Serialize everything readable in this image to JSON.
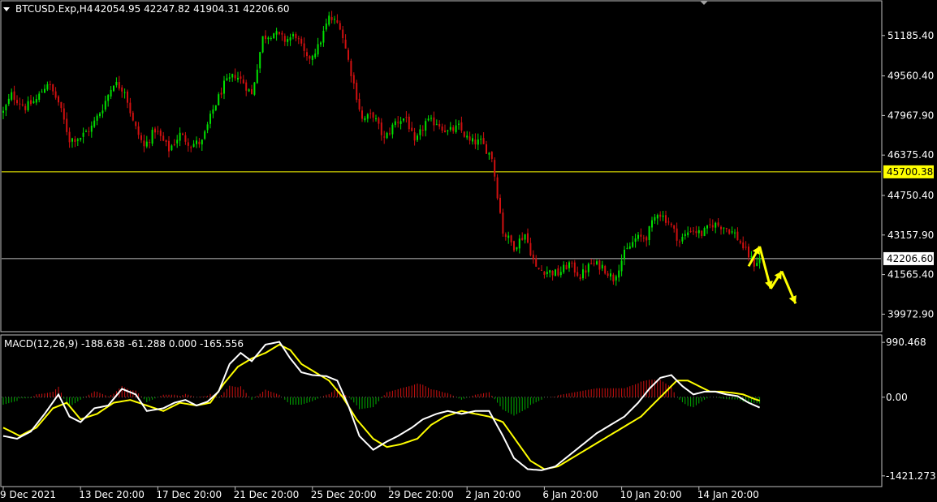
{
  "header": {
    "symbol": "BTCUSD.Exp,H4",
    "ohlc": "42054.95 42247.82 41904.31 42206.60",
    "macd_label": "MACD(12,26,9) -188.638 -61.288 0.000 -165.556"
  },
  "colors": {
    "background": "#000000",
    "bull": "#00e000",
    "bear": "#d01010",
    "macd_line": "#ffffff",
    "signal_line": "#ffff00",
    "hist_pos": "#d01010",
    "hist_neg": "#00b000",
    "resistance": "#ffff00",
    "current": "#c0c0c0",
    "arrows": "#ffff00"
  },
  "chart_data": [
    {
      "type": "candlestick",
      "price_ticks": [
        {
          "value": 51185.4,
          "label": "51185.40"
        },
        {
          "value": 49560.4,
          "label": "49560.40"
        },
        {
          "value": 47967.9,
          "label": "47967.90"
        },
        {
          "value": 46375.4,
          "label": "46375.40"
        },
        {
          "value": 44750.4,
          "label": "44750.40"
        },
        {
          "value": 43157.9,
          "label": "43157.90"
        },
        {
          "value": 41565.4,
          "label": "41565.40"
        },
        {
          "value": 39972.9,
          "label": "39972.90"
        }
      ],
      "ylim": [
        39300,
        52550
      ],
      "horizontal_lines": [
        {
          "value": 45700.38,
          "label": "45700.38",
          "kind": "resistance"
        },
        {
          "value": 42206.6,
          "label": "42206.60",
          "kind": "current"
        }
      ],
      "time_labels": [
        "9 Dec 2021",
        "13 Dec 20:00",
        "17 Dec 20:00",
        "21 Dec 20:00",
        "25 Dec 20:00",
        "29 Dec 20:00",
        "2 Jan 20:00",
        "6 Jan 20:00",
        "10 Jan 20:00",
        "14 Jan 20:00"
      ],
      "closes": [
        [
          0,
          48100
        ],
        [
          3,
          48800
        ],
        [
          8,
          48300
        ],
        [
          12,
          48600
        ],
        [
          16,
          49300
        ],
        [
          20,
          48500
        ],
        [
          24,
          47000
        ],
        [
          28,
          47100
        ],
        [
          32,
          47500
        ],
        [
          36,
          48300
        ],
        [
          40,
          49300
        ],
        [
          44,
          49000
        ],
        [
          47,
          47700
        ],
        [
          51,
          46700
        ],
        [
          55,
          47400
        ],
        [
          60,
          46600
        ],
        [
          64,
          47200
        ],
        [
          68,
          46800
        ],
        [
          72,
          46900
        ],
        [
          76,
          48200
        ],
        [
          80,
          49200
        ],
        [
          84,
          49600
        ],
        [
          87,
          49300
        ],
        [
          90,
          48800
        ],
        [
          94,
          51100
        ],
        [
          98,
          51300
        ],
        [
          102,
          51000
        ],
        [
          106,
          51200
        ],
        [
          110,
          50200
        ],
        [
          114,
          50700
        ],
        [
          118,
          51900
        ],
        [
          122,
          51600
        ],
        [
          126,
          49700
        ],
        [
          130,
          47800
        ],
        [
          134,
          48000
        ],
        [
          138,
          47000
        ],
        [
          142,
          47700
        ],
        [
          146,
          47900
        ],
        [
          149,
          46800
        ],
        [
          153,
          47700
        ],
        [
          157,
          47700
        ],
        [
          161,
          47300
        ],
        [
          165,
          47500
        ],
        [
          169,
          46900
        ],
        [
          173,
          46900
        ],
        [
          177,
          46300
        ],
        [
          181,
          43300
        ],
        [
          185,
          42700
        ],
        [
          189,
          43200
        ],
        [
          193,
          41800
        ],
        [
          197,
          41700
        ],
        [
          201,
          41600
        ],
        [
          205,
          42000
        ],
        [
          209,
          41500
        ],
        [
          213,
          42000
        ],
        [
          217,
          41900
        ],
        [
          221,
          41400
        ],
        [
          225,
          42400
        ],
        [
          229,
          43000
        ],
        [
          233,
          43100
        ],
        [
          237,
          44100
        ],
        [
          241,
          43700
        ],
        [
          245,
          42900
        ],
        [
          249,
          43400
        ],
        [
          253,
          43200
        ],
        [
          257,
          43600
        ],
        [
          261,
          43500
        ],
        [
          265,
          43200
        ],
        [
          269,
          42500
        ],
        [
          272,
          42000
        ],
        [
          274,
          42206.6
        ]
      ],
      "forecast_arrows": [
        [
          [
            270,
            41900
          ],
          [
            274,
            42700
          ]
        ],
        [
          [
            274,
            42700
          ],
          [
            278,
            41000
          ]
        ],
        [
          [
            278,
            41000
          ],
          [
            282,
            41700
          ]
        ],
        [
          [
            282,
            41700
          ],
          [
            287,
            40400
          ]
        ]
      ]
    },
    {
      "type": "macd",
      "params": "12,26,9",
      "ticks": [
        {
          "value": 990.468,
          "label": "990.468"
        },
        {
          "value": 0.0,
          "label": "0.00"
        },
        {
          "value": -1421.273,
          "label": "-1421.273"
        }
      ],
      "ylim": [
        -1600,
        1110
      ],
      "macd": [
        [
          0,
          -700
        ],
        [
          5,
          -750
        ],
        [
          10,
          -620
        ],
        [
          15,
          -300
        ],
        [
          20,
          50
        ],
        [
          24,
          -350
        ],
        [
          28,
          -450
        ],
        [
          33,
          -200
        ],
        [
          38,
          -150
        ],
        [
          43,
          150
        ],
        [
          48,
          50
        ],
        [
          52,
          -250
        ],
        [
          58,
          -200
        ],
        [
          62,
          -100
        ],
        [
          66,
          -50
        ],
        [
          70,
          -150
        ],
        [
          74,
          -80
        ],
        [
          78,
          100
        ],
        [
          82,
          600
        ],
        [
          86,
          800
        ],
        [
          90,
          650
        ],
        [
          95,
          950
        ],
        [
          100,
          1000
        ],
        [
          104,
          700
        ],
        [
          108,
          450
        ],
        [
          112,
          400
        ],
        [
          117,
          380
        ],
        [
          121,
          300
        ],
        [
          125,
          -150
        ],
        [
          129,
          -700
        ],
        [
          134,
          -950
        ],
        [
          139,
          -800
        ],
        [
          143,
          -700
        ],
        [
          148,
          -550
        ],
        [
          152,
          -400
        ],
        [
          157,
          -300
        ],
        [
          161,
          -250
        ],
        [
          166,
          -300
        ],
        [
          171,
          -250
        ],
        [
          176,
          -250
        ],
        [
          181,
          -700
        ],
        [
          185,
          -1100
        ],
        [
          190,
          -1300
        ],
        [
          195,
          -1320
        ],
        [
          200,
          -1250
        ],
        [
          205,
          -1050
        ],
        [
          210,
          -850
        ],
        [
          215,
          -650
        ],
        [
          220,
          -500
        ],
        [
          225,
          -350
        ],
        [
          230,
          -100
        ],
        [
          234,
          150
        ],
        [
          238,
          350
        ],
        [
          242,
          400
        ],
        [
          246,
          200
        ],
        [
          250,
          50
        ],
        [
          254,
          100
        ],
        [
          258,
          100
        ],
        [
          262,
          50
        ],
        [
          266,
          20
        ],
        [
          270,
          -100
        ],
        [
          274,
          -188.6
        ]
      ],
      "signal": [
        [
          0,
          -550
        ],
        [
          6,
          -700
        ],
        [
          12,
          -550
        ],
        [
          18,
          -200
        ],
        [
          23,
          -100
        ],
        [
          28,
          -400
        ],
        [
          34,
          -300
        ],
        [
          40,
          -100
        ],
        [
          46,
          -50
        ],
        [
          52,
          -150
        ],
        [
          58,
          -250
        ],
        [
          64,
          -100
        ],
        [
          70,
          -150
        ],
        [
          75,
          -100
        ],
        [
          80,
          250
        ],
        [
          85,
          550
        ],
        [
          90,
          700
        ],
        [
          95,
          800
        ],
        [
          100,
          950
        ],
        [
          104,
          850
        ],
        [
          108,
          600
        ],
        [
          113,
          450
        ],
        [
          118,
          300
        ],
        [
          123,
          0
        ],
        [
          128,
          -400
        ],
        [
          134,
          -750
        ],
        [
          139,
          -900
        ],
        [
          144,
          -850
        ],
        [
          150,
          -750
        ],
        [
          155,
          -500
        ],
        [
          160,
          -350
        ],
        [
          166,
          -250
        ],
        [
          171,
          -300
        ],
        [
          176,
          -350
        ],
        [
          181,
          -450
        ],
        [
          186,
          -800
        ],
        [
          191,
          -1150
        ],
        [
          196,
          -1300
        ],
        [
          201,
          -1250
        ],
        [
          206,
          -1100
        ],
        [
          211,
          -950
        ],
        [
          216,
          -800
        ],
        [
          221,
          -650
        ],
        [
          226,
          -500
        ],
        [
          231,
          -350
        ],
        [
          236,
          -100
        ],
        [
          240,
          100
        ],
        [
          244,
          300
        ],
        [
          248,
          300
        ],
        [
          252,
          200
        ],
        [
          256,
          100
        ],
        [
          260,
          100
        ],
        [
          264,
          80
        ],
        [
          268,
          50
        ],
        [
          272,
          -30
        ],
        [
          274,
          -61.3
        ]
      ]
    }
  ]
}
